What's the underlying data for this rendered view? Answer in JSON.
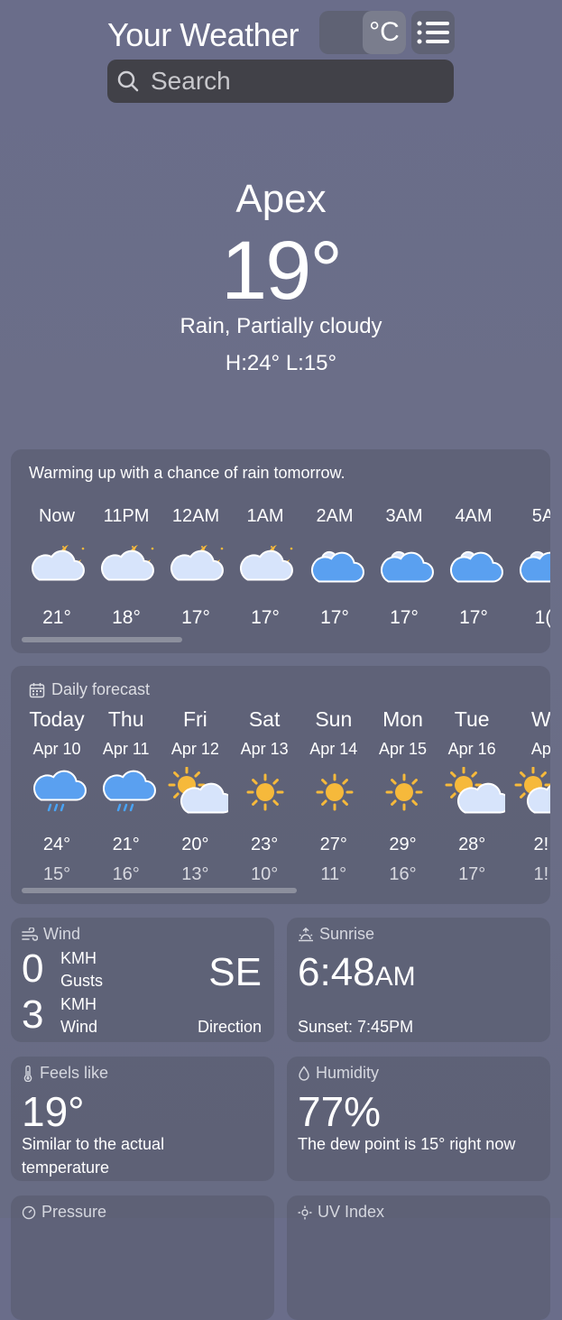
{
  "header": {
    "title": "Your Weather",
    "unit_c": "°C",
    "search_placeholder": "Search"
  },
  "current": {
    "city": "Apex",
    "temp": "19°",
    "condition": "Rain, Partially cloudy",
    "hi_lo": "H:24°  L:15°"
  },
  "hourly": {
    "summary": "Warming up with a chance of rain tomorrow.",
    "items": [
      {
        "time": "Now",
        "temp": "21°",
        "icon": "partly-cloudy-night-icon"
      },
      {
        "time": "11PM",
        "temp": "18°",
        "icon": "partly-cloudy-night-icon"
      },
      {
        "time": "12AM",
        "temp": "17°",
        "icon": "partly-cloudy-night-icon"
      },
      {
        "time": "1AM",
        "temp": "17°",
        "icon": "partly-cloudy-night-icon"
      },
      {
        "time": "2AM",
        "temp": "17°",
        "icon": "cloudy-icon"
      },
      {
        "time": "3AM",
        "temp": "17°",
        "icon": "cloudy-icon"
      },
      {
        "time": "4AM",
        "temp": "17°",
        "icon": "cloudy-icon"
      },
      {
        "time": "5A",
        "temp": "1(",
        "icon": "cloudy-icon"
      }
    ]
  },
  "daily": {
    "heading": "Daily forecast",
    "items": [
      {
        "day": "Today",
        "date": "Apr 10",
        "hi": "24°",
        "lo": "15°",
        "icon": "rain-icon"
      },
      {
        "day": "Thu",
        "date": "Apr 11",
        "hi": "21°",
        "lo": "16°",
        "icon": "rain-icon"
      },
      {
        "day": "Fri",
        "date": "Apr 12",
        "hi": "20°",
        "lo": "13°",
        "icon": "partly-cloudy-day-icon"
      },
      {
        "day": "Sat",
        "date": "Apr 13",
        "hi": "23°",
        "lo": "10°",
        "icon": "sun-icon"
      },
      {
        "day": "Sun",
        "date": "Apr 14",
        "hi": "27°",
        "lo": "11°",
        "icon": "sun-icon"
      },
      {
        "day": "Mon",
        "date": "Apr 15",
        "hi": "29°",
        "lo": "16°",
        "icon": "sun-icon"
      },
      {
        "day": "Tue",
        "date": "Apr 16",
        "hi": "28°",
        "lo": "17°",
        "icon": "partly-cloudy-day-icon"
      },
      {
        "day": "W",
        "date": "Ap",
        "hi": "2!",
        "lo": "1!",
        "icon": "partly-cloudy-day-icon"
      }
    ]
  },
  "wind": {
    "label": "Wind",
    "speed": "0",
    "speed_unit": "KMH",
    "speed_desc": "Gusts",
    "gust": "3",
    "gust_unit": "KMH",
    "gust_desc": "Wind",
    "direction": "SE",
    "direction_label": "Direction"
  },
  "sunrise": {
    "label": "Sunrise",
    "time": "6:48",
    "ampm": "AM",
    "sunset": "Sunset: 7:45PM"
  },
  "feels_like": {
    "label": "Feels like",
    "value": "19°",
    "desc": "Similar to the actual temperature"
  },
  "humidity": {
    "label": "Humidity",
    "value": "77%",
    "desc": "The dew point is 15° right now"
  },
  "pressure": {
    "label": "Pressure"
  },
  "uv": {
    "label": "UV Index"
  },
  "colors": {
    "sun": "#f6b93b",
    "cloud": "#d7e4fb",
    "cloud_blue": "#5aa0f0",
    "rain": "#4aa3f5"
  }
}
